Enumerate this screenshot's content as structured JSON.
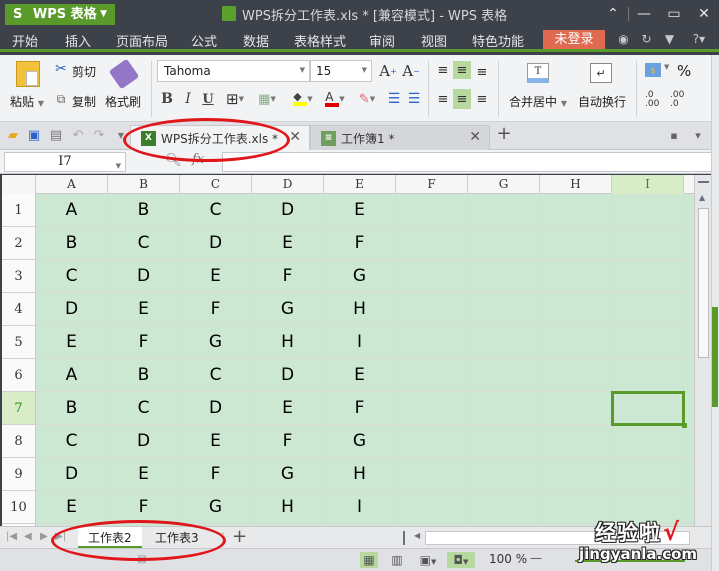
{
  "app": {
    "name": "WPS 表格",
    "logo_glyph": "S",
    "window_title": "WPS拆分工作表.xls * [兼容模式] - WPS 表格"
  },
  "window_controls": {
    "collapse": "⌃",
    "minimize": "—",
    "maximize": "▭",
    "close": "✕"
  },
  "menu": {
    "items": [
      "开始",
      "插入",
      "页面布局",
      "公式",
      "数据",
      "表格样式",
      "审阅",
      "视图",
      "特色功能"
    ],
    "active": "开始",
    "login_label": "未登录",
    "right_icons": [
      "browser-icon",
      "sync-icon",
      "skin-icon",
      "help-icon"
    ],
    "help_label": "?"
  },
  "ribbon": {
    "paste": "粘贴",
    "cut": "剪切",
    "copy": "复制",
    "format_painter": "格式刷",
    "font_name": "Tahoma",
    "font_size": "15",
    "bold": "B",
    "italic": "I",
    "underline": "U",
    "grow_font": "A",
    "shrink_font": "A",
    "merge_center": "合并居中",
    "wrap_text": "自动换行",
    "percent": "%",
    "inc_decimal": ".0 .00",
    "dec_decimal": ".00 .0",
    "fill_color": "#ffff00",
    "font_color": "#e00000"
  },
  "doc_tabs": [
    {
      "label": "WPS拆分工作表.xls *",
      "active": true
    },
    {
      "label": "工作簿1 *",
      "active": false
    }
  ],
  "formula_bar": {
    "name_box": "I7",
    "fx_label": "fx",
    "formula": ""
  },
  "sheet": {
    "columns": [
      "A",
      "B",
      "C",
      "D",
      "E",
      "F",
      "G",
      "H",
      "I"
    ],
    "selected_column": "I",
    "selected_row": "7",
    "active_cell": "I7",
    "rows": [
      {
        "num": "1",
        "cells": [
          "A",
          "B",
          "C",
          "D",
          "E"
        ]
      },
      {
        "num": "2",
        "cells": [
          "B",
          "C",
          "D",
          "E",
          "F"
        ]
      },
      {
        "num": "3",
        "cells": [
          "C",
          "D",
          "E",
          "F",
          "G"
        ]
      },
      {
        "num": "4",
        "cells": [
          "D",
          "E",
          "F",
          "G",
          "H"
        ]
      },
      {
        "num": "5",
        "cells": [
          "E",
          "F",
          "G",
          "H",
          "I"
        ]
      },
      {
        "num": "6",
        "cells": [
          "A",
          "B",
          "C",
          "D",
          "E"
        ]
      },
      {
        "num": "7",
        "cells": [
          "B",
          "C",
          "D",
          "E",
          "F"
        ]
      },
      {
        "num": "8",
        "cells": [
          "C",
          "D",
          "E",
          "F",
          "G"
        ]
      },
      {
        "num": "9",
        "cells": [
          "D",
          "E",
          "F",
          "G",
          "H"
        ]
      },
      {
        "num": "10",
        "cells": [
          "E",
          "F",
          "G",
          "H",
          "I"
        ]
      }
    ]
  },
  "sheet_tabs": {
    "tabs": [
      "工作表2",
      "工作表3"
    ],
    "active": "工作表2",
    "more": "···",
    "add": "+"
  },
  "status_bar": {
    "zoom": "100 %",
    "zoom_minus": "—"
  },
  "watermark": {
    "text": "经验啦",
    "check": "√",
    "url": "jingyanla.com"
  },
  "colors": {
    "accent": "#5a9a2a",
    "login": "#e06a50",
    "cell_bg": "#cde8d2",
    "annotation": "#e0161b"
  }
}
